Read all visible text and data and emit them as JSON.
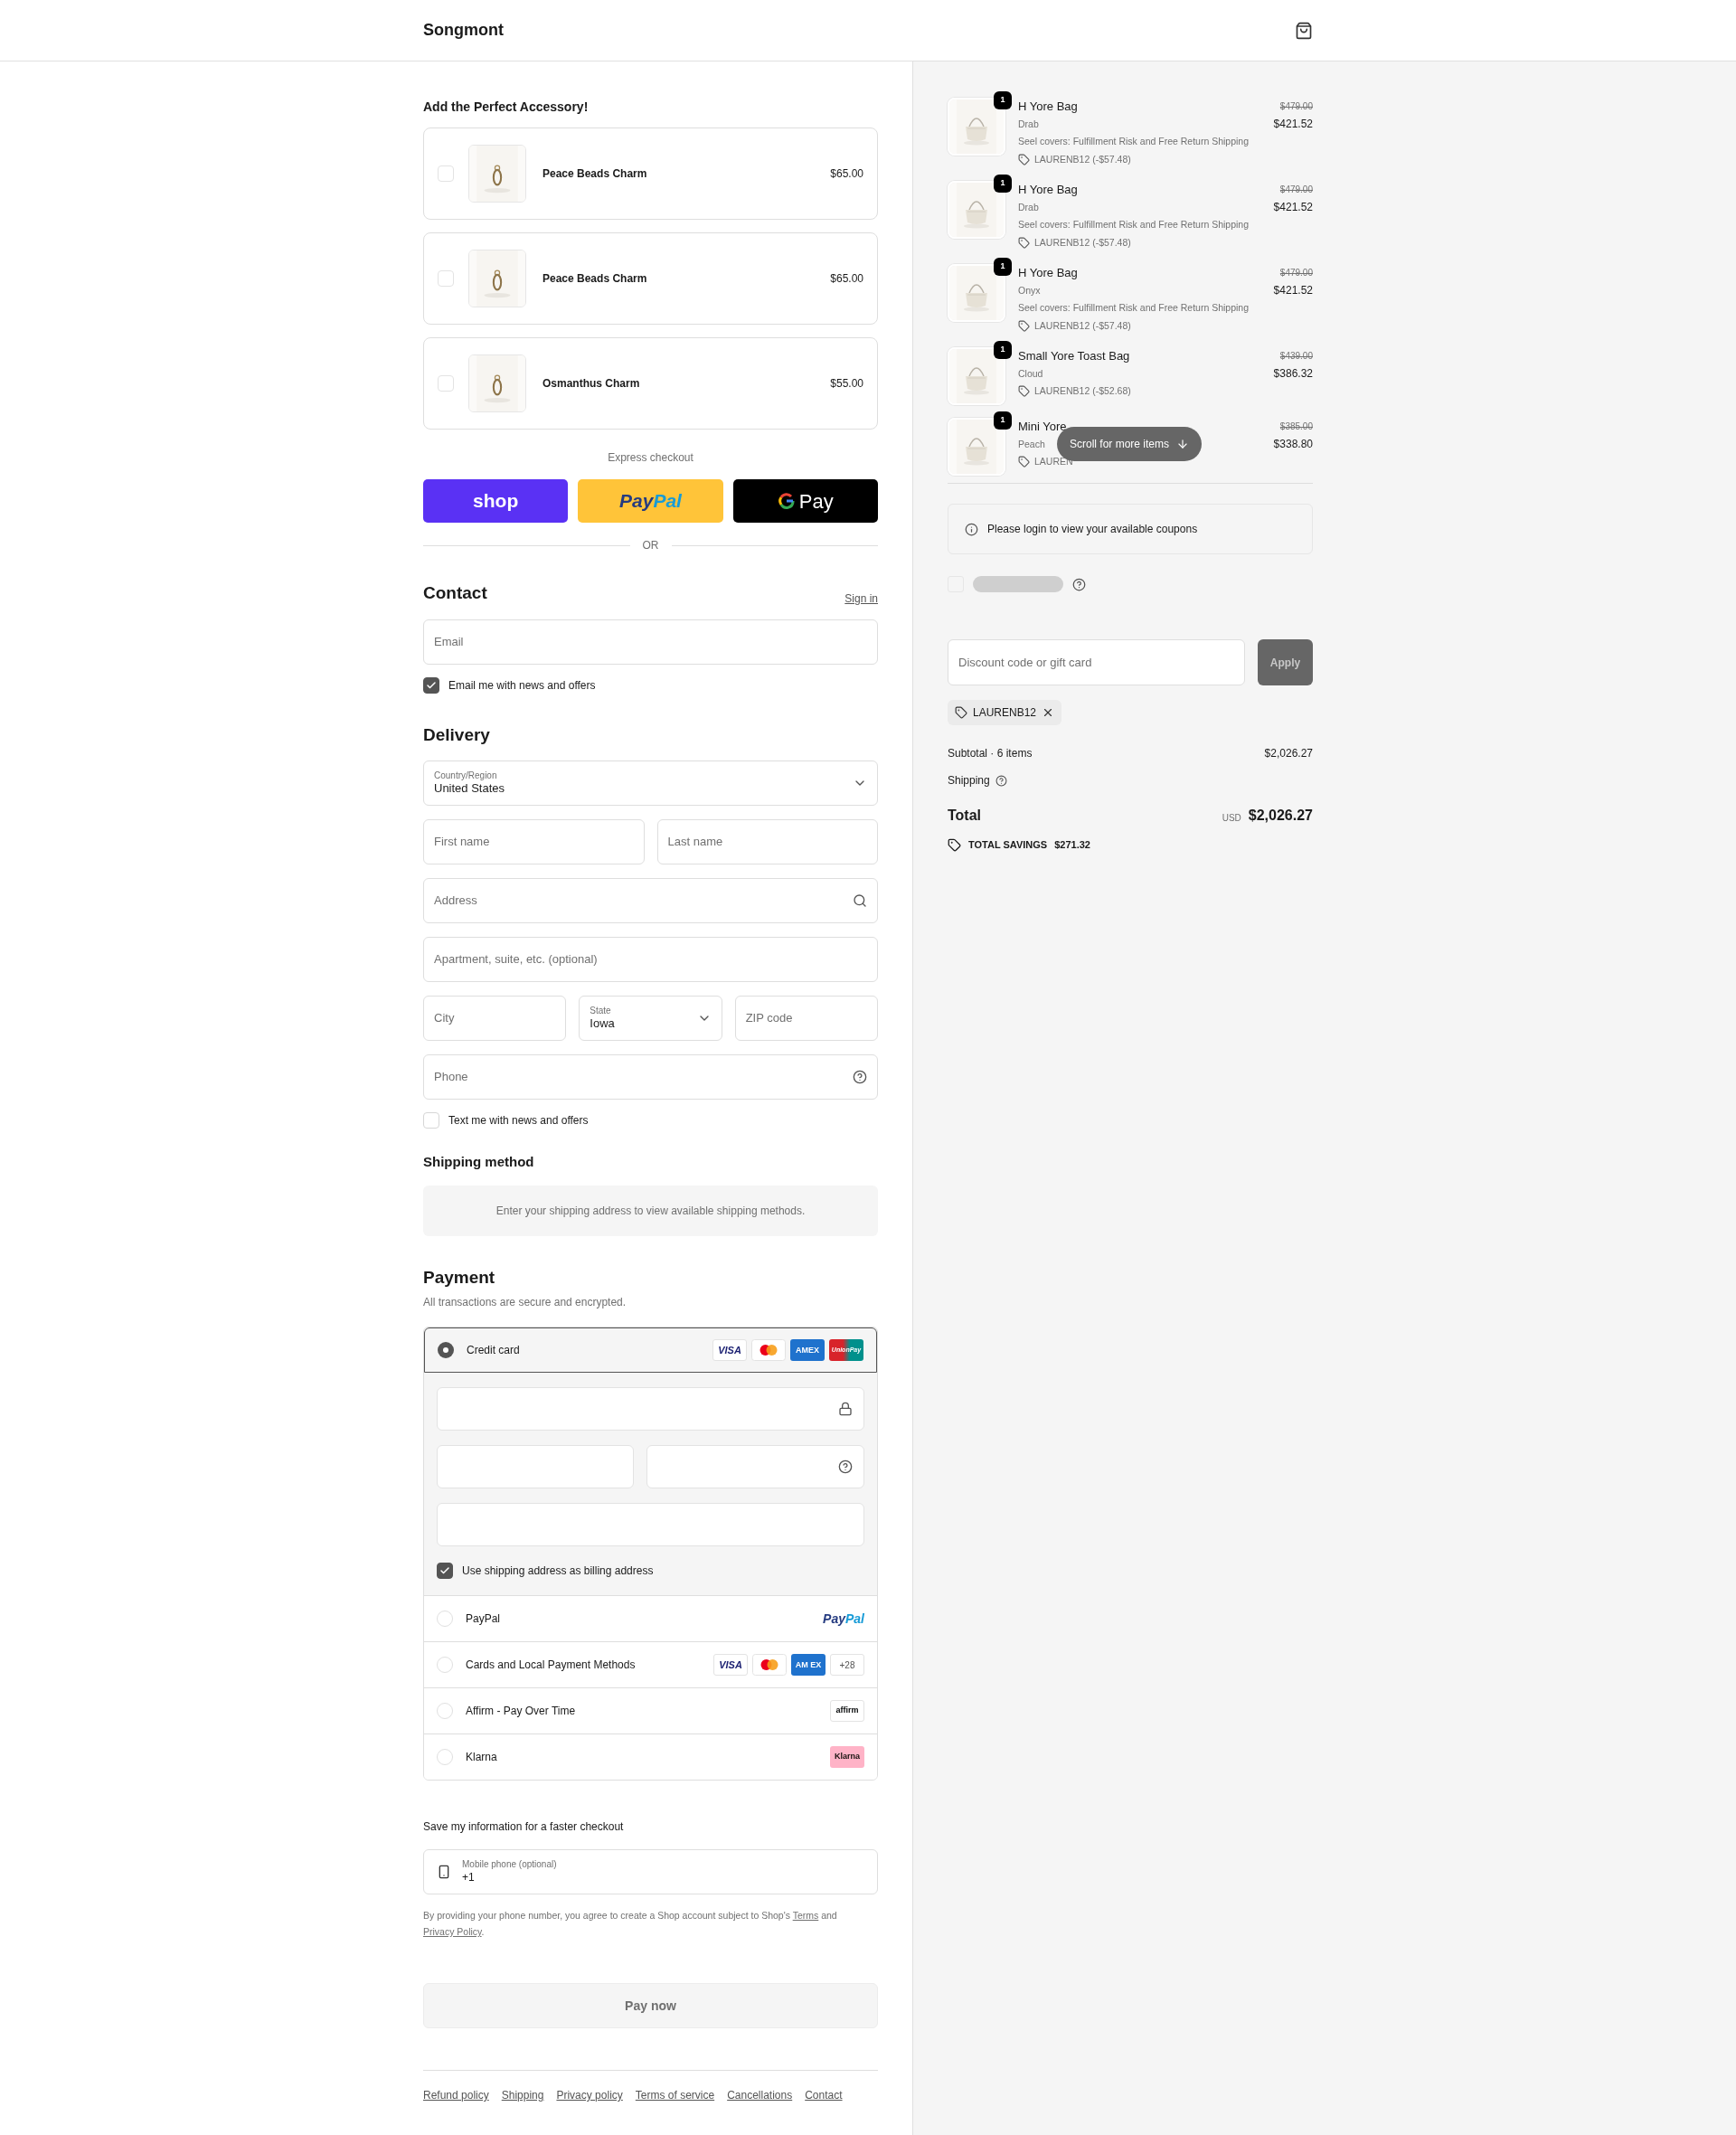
{
  "header": {
    "brand": "Songmont"
  },
  "upsell": {
    "title": "Add the Perfect Accessory!",
    "items": [
      {
        "name": "Peace Beads Charm",
        "price": "$65.00",
        "checked": false
      },
      {
        "name": "Peace Beads Charm",
        "price": "$65.00",
        "checked": false
      },
      {
        "name": "Osmanthus Charm",
        "price": "$55.00",
        "checked": false
      }
    ]
  },
  "express": {
    "label": "Express checkout",
    "divider": "OR",
    "buttons": [
      {
        "kind": "shop",
        "parts": [
          "shop"
        ]
      },
      {
        "kind": "paypal",
        "parts": [
          "Pay",
          "Pal"
        ]
      },
      {
        "kind": "gpay",
        "parts": [
          "Pay"
        ]
      }
    ]
  },
  "contact": {
    "title": "Contact",
    "sign_in": "Sign in",
    "email": {
      "placeholder": "Email"
    },
    "newsletter": {
      "label": "Email me with news and offers",
      "checked": true
    }
  },
  "delivery": {
    "title": "Delivery",
    "country": {
      "label": "Country/Region",
      "value": "United States"
    },
    "first_name": {
      "placeholder": "First name"
    },
    "last_name": {
      "placeholder": "Last name"
    },
    "address": {
      "placeholder": "Address"
    },
    "apartment": {
      "placeholder": "Apartment, suite, etc. (optional)"
    },
    "city": {
      "placeholder": "City"
    },
    "state": {
      "label": "State",
      "value": "Iowa"
    },
    "zip": {
      "placeholder": "ZIP code"
    },
    "phone": {
      "placeholder": "Phone"
    },
    "sms": {
      "label": "Text me with news and offers",
      "checked": false
    }
  },
  "shipping_method": {
    "title": "Shipping method",
    "message": "Enter your shipping address to view available shipping methods."
  },
  "payment": {
    "title": "Payment",
    "subtitle": "All transactions are secure and encrypted.",
    "methods": [
      {
        "kind": "credit_card",
        "label": "Credit card",
        "selected": true,
        "logos": [
          {
            "kind": "visa",
            "text": "VISA"
          },
          {
            "kind": "mastercard"
          },
          {
            "kind": "amex",
            "text": "AMEX"
          },
          {
            "kind": "unionpay",
            "text": "UnionPay"
          }
        ]
      },
      {
        "kind": "paypal",
        "label": "PayPal",
        "selected": false,
        "logos": [
          {
            "kind": "paypal_word",
            "parts": [
              "Pay",
              "Pal"
            ]
          }
        ]
      },
      {
        "kind": "cards",
        "label": "Cards and Local Payment Methods",
        "selected": false,
        "logos": [
          {
            "kind": "visa",
            "text": "VISA"
          },
          {
            "kind": "mastercard"
          },
          {
            "kind": "amex",
            "text": "AM EX"
          },
          {
            "kind": "more",
            "text": "+28"
          }
        ]
      },
      {
        "kind": "affirm",
        "label": "Affirm - Pay Over Time",
        "selected": false,
        "logos": [
          {
            "kind": "affirm",
            "text": "affirm"
          }
        ]
      },
      {
        "kind": "klarna",
        "label": "Klarna",
        "selected": false,
        "logos": [
          {
            "kind": "klarna",
            "text": "Klarna"
          }
        ]
      }
    ],
    "billing": {
      "label": "Use shipping address as billing address",
      "checked": true
    }
  },
  "save_info": {
    "title": "Save my information for a faster checkout",
    "phone": {
      "label": "Mobile phone (optional)",
      "value": "+1"
    },
    "disclaimer": "By providing your phone number, you agree to create a Shop account subject to Shop's",
    "terms": "Terms",
    "joiner": "and",
    "privacy": "Privacy Policy",
    "end": "."
  },
  "pay_button": "Pay now",
  "footer_links": [
    "Refund policy",
    "Shipping",
    "Privacy policy",
    "Terms of service",
    "Cancellations",
    "Contact"
  ],
  "summary": {
    "items": [
      {
        "quantity": "1",
        "name": "H Yore Bag",
        "variant": "Drab",
        "note": "Seel covers: Fulfillment Risk and Free Return Shipping",
        "discount": "LAURENB12 (-$57.48)",
        "original_price": "$479.00",
        "price": "$421.52"
      },
      {
        "quantity": "1",
        "name": "H Yore Bag",
        "variant": "Drab",
        "note": "Seel covers: Fulfillment Risk and Free Return Shipping",
        "discount": "LAURENB12 (-$57.48)",
        "original_price": "$479.00",
        "price": "$421.52"
      },
      {
        "quantity": "1",
        "name": "H Yore Bag",
        "variant": "Onyx",
        "note": "Seel covers: Fulfillment Risk and Free Return Shipping",
        "discount": "LAURENB12 (-$57.48)",
        "original_price": "$479.00",
        "price": "$421.52"
      },
      {
        "quantity": "1",
        "name": "Small Yore Toast Bag",
        "variant": "Cloud",
        "discount": "LAURENB12 (-$52.68)",
        "original_price": "$439.00",
        "price": "$386.32"
      },
      {
        "quantity": "1",
        "name": "Mini Yore",
        "variant": "Peach",
        "discount": "LAUREN",
        "original_price": "$385.00",
        "price": "$338.80"
      }
    ],
    "scroll_hint": "Scroll for more items",
    "coupon_notice": "Please login to view your available coupons",
    "points_checkbox": {
      "checked": false
    },
    "discount": {
      "placeholder": "Discount code or gift card",
      "button": "Apply"
    },
    "applied_code": "LAURENB12",
    "subtotal": {
      "label": "Subtotal · 6 items",
      "value": "$2,026.27"
    },
    "shipping_label": "Shipping",
    "total": {
      "label": "Total",
      "currency": "USD",
      "value": "$2,026.27"
    },
    "savings": {
      "label": "TOTAL SAVINGS",
      "value": "$271.32"
    }
  }
}
